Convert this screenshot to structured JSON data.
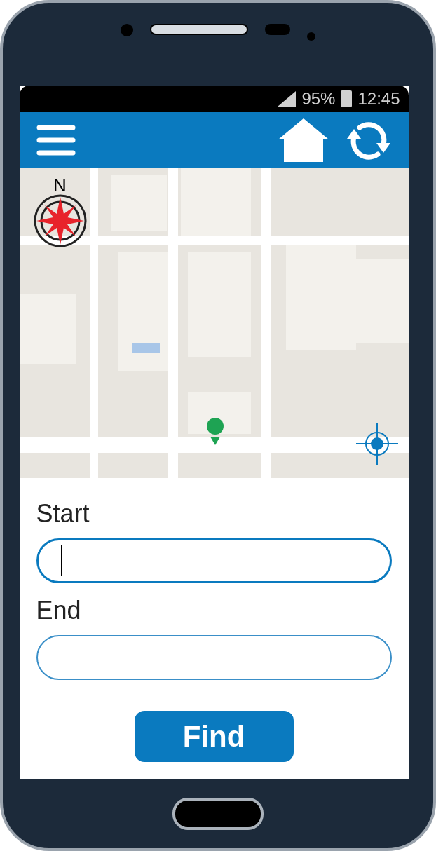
{
  "status_bar": {
    "battery": "95%",
    "time": "12:45"
  },
  "map": {
    "compass_label": "N"
  },
  "form": {
    "fields": [
      {
        "label": "Start",
        "focused": true
      },
      {
        "label": "End",
        "focused": false
      }
    ],
    "button": "Find"
  }
}
